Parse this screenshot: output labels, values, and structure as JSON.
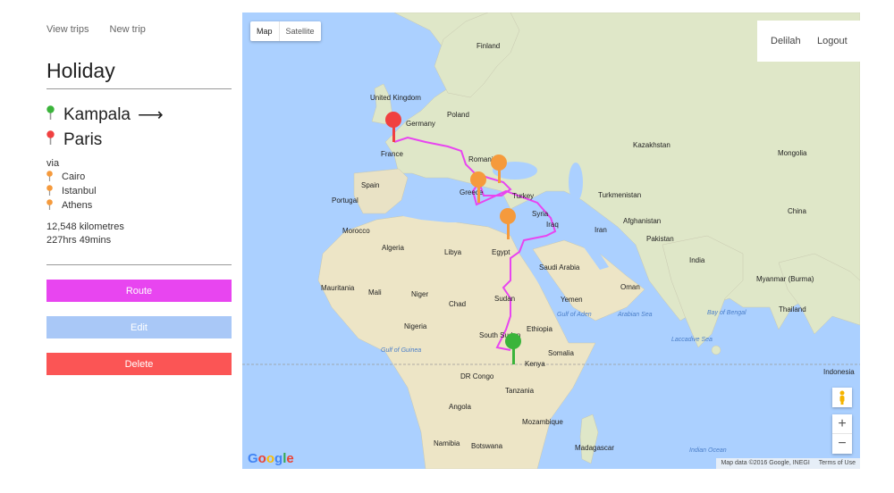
{
  "nav": {
    "view_trips": "View trips",
    "new_trip": "New trip"
  },
  "trip": {
    "title": "Holiday",
    "origin": "Kampala",
    "destination": "Paris",
    "via_label": "via",
    "stops": [
      "Cairo",
      "Istanbul",
      "Athens"
    ],
    "distance": "12,548 kilometres",
    "duration": "227hrs 49mins"
  },
  "buttons": {
    "route": "Route",
    "edit": "Edit",
    "delete": "Delete"
  },
  "colors": {
    "route": "#e845f0",
    "edit": "#a9c8f7",
    "delete": "#fb5555",
    "origin_pin": "#3bb43b",
    "destination_pin": "#f04040",
    "stop_pin": "#f59a3c"
  },
  "map": {
    "type_map": "Map",
    "type_satellite": "Satellite",
    "user": "Delilah",
    "logout": "Logout",
    "zoom_in": "+",
    "zoom_out": "−",
    "logo": "Google",
    "attribution": "Map data ©2016 Google, INEGI",
    "terms": "Terms of Use",
    "labels": {
      "united_kingdom": "United Kingdom",
      "finland": "Finland",
      "poland": "Poland",
      "germany": "Germany",
      "france": "France",
      "spain": "Spain",
      "portugal": "Portugal",
      "romania": "Romania",
      "greece": "Greece",
      "turkey": "Turkey",
      "syria": "Syria",
      "iraq": "Iraq",
      "kazakhstan": "Kazakhstan",
      "mongolia": "Mongolia",
      "turkmenistan": "Turkmenistan",
      "afghanistan": "Afghanistan",
      "pakistan": "Pakistan",
      "iran": "Iran",
      "china": "China",
      "india": "India",
      "myanmar": "Myanmar (Burma)",
      "thailand": "Thailand",
      "morocco": "Morocco",
      "algeria": "Algeria",
      "libya": "Libya",
      "egypt": "Egypt",
      "saudi_arabia": "Saudi Arabia",
      "oman": "Oman",
      "yemen": "Yemen",
      "mauritania": "Mauritania",
      "mali": "Mali",
      "niger": "Niger",
      "chad": "Chad",
      "sudan": "Sudan",
      "nigeria": "Nigeria",
      "ethiopia": "Ethiopia",
      "south_sudan": "South Sudan",
      "somalia": "Somalia",
      "kenya": "Kenya",
      "dr_congo": "DR Congo",
      "tanzania": "Tanzania",
      "angola": "Angola",
      "namibia": "Namibia",
      "botswana": "Botswana",
      "mozambique": "Mozambique",
      "madagascar": "Madagascar",
      "indonesia": "Indonesia",
      "gulf_of_guinea": "Gulf of Guinea",
      "gulf_of_aden": "Gulf of Aden",
      "arabian_sea": "Arabian Sea",
      "bay_of_bengal": "Bay of Bengal",
      "laccadive_sea": "Laccadive Sea",
      "indian_ocean": "Indian Ocean"
    }
  }
}
